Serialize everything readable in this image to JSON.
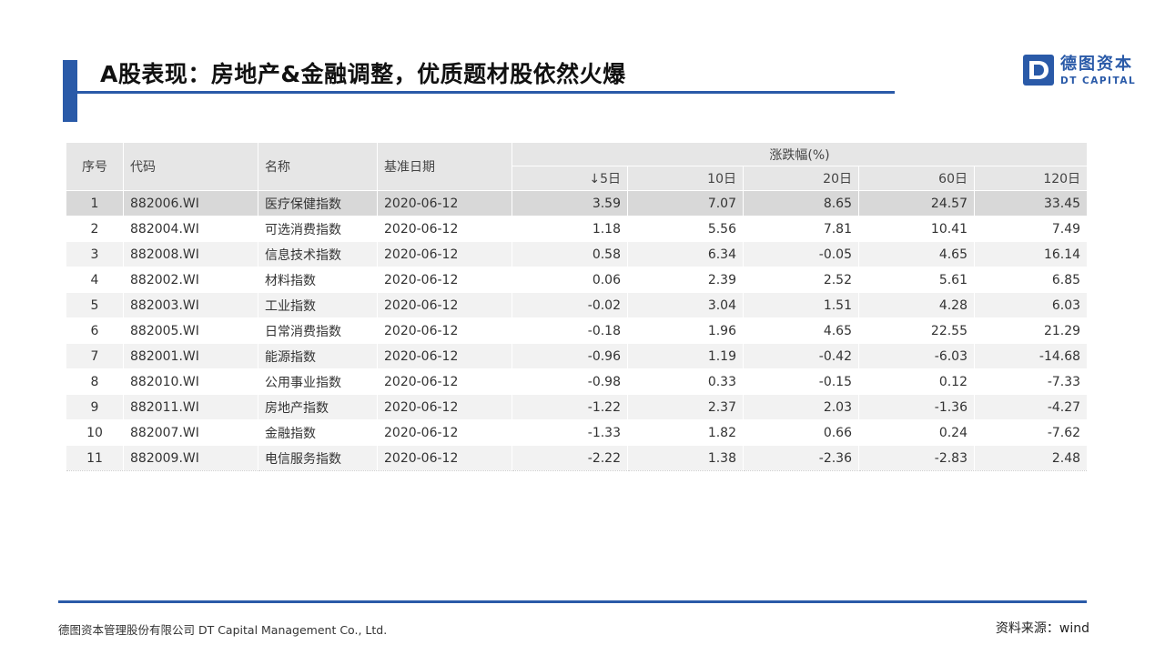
{
  "header": {
    "title": "A股表现：房地产&金融调整，优质题材股依然火爆",
    "accent_color": "#2a5aa8"
  },
  "logo": {
    "mark_icon": "dt-capital-logo-icon",
    "name_cn": "德图资本",
    "name_en": "DT CAPITAL"
  },
  "table": {
    "columns": {
      "index": "序号",
      "code": "代码",
      "name": "名称",
      "date": "基准日期",
      "change_group": "涨跌幅(%)",
      "sort_icon": "arrow-down-icon",
      "sort_glyph": "↓",
      "periods": [
        "5日",
        "10日",
        "20日",
        "60日",
        "120日"
      ]
    },
    "rows": [
      {
        "index": "1",
        "code": "882006.WI",
        "name": "医疗保健指数",
        "date": "2020-06-12",
        "values": [
          "3.59",
          "7.07",
          "8.65",
          "24.57",
          "33.45"
        ]
      },
      {
        "index": "2",
        "code": "882004.WI",
        "name": "可选消费指数",
        "date": "2020-06-12",
        "values": [
          "1.18",
          "5.56",
          "7.81",
          "10.41",
          "7.49"
        ]
      },
      {
        "index": "3",
        "code": "882008.WI",
        "name": "信息技术指数",
        "date": "2020-06-12",
        "values": [
          "0.58",
          "6.34",
          "-0.05",
          "4.65",
          "16.14"
        ]
      },
      {
        "index": "4",
        "code": "882002.WI",
        "name": "材料指数",
        "date": "2020-06-12",
        "values": [
          "0.06",
          "2.39",
          "2.52",
          "5.61",
          "6.85"
        ]
      },
      {
        "index": "5",
        "code": "882003.WI",
        "name": "工业指数",
        "date": "2020-06-12",
        "values": [
          "-0.02",
          "3.04",
          "1.51",
          "4.28",
          "6.03"
        ]
      },
      {
        "index": "6",
        "code": "882005.WI",
        "name": "日常消费指数",
        "date": "2020-06-12",
        "values": [
          "-0.18",
          "1.96",
          "4.65",
          "22.55",
          "21.29"
        ]
      },
      {
        "index": "7",
        "code": "882001.WI",
        "name": "能源指数",
        "date": "2020-06-12",
        "values": [
          "-0.96",
          "1.19",
          "-0.42",
          "-6.03",
          "-14.68"
        ]
      },
      {
        "index": "8",
        "code": "882010.WI",
        "name": "公用事业指数",
        "date": "2020-06-12",
        "values": [
          "-0.98",
          "0.33",
          "-0.15",
          "0.12",
          "-7.33"
        ]
      },
      {
        "index": "9",
        "code": "882011.WI",
        "name": "房地产指数",
        "date": "2020-06-12",
        "values": [
          "-1.22",
          "2.37",
          "2.03",
          "-1.36",
          "-4.27"
        ]
      },
      {
        "index": "10",
        "code": "882007.WI",
        "name": "金融指数",
        "date": "2020-06-12",
        "values": [
          "-1.33",
          "1.82",
          "0.66",
          "0.24",
          "-7.62"
        ]
      },
      {
        "index": "11",
        "code": "882009.WI",
        "name": "电信服务指数",
        "date": "2020-06-12",
        "values": [
          "-2.22",
          "1.38",
          "-2.36",
          "-2.83",
          "2.48"
        ]
      }
    ]
  },
  "footer": {
    "company": "德图资本管理股份有限公司  DT Capital Management Co., Ltd.",
    "source": "资料来源：wind"
  }
}
